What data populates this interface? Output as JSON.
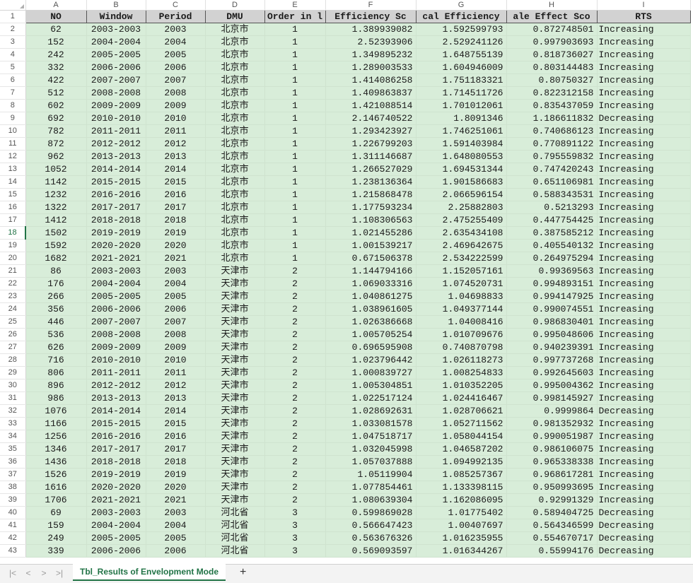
{
  "columns": [
    "A",
    "B",
    "C",
    "D",
    "E",
    "F",
    "G",
    "H",
    "I"
  ],
  "header": [
    "NO",
    "Window",
    "Period",
    "DMU",
    "Order in l",
    "Efficiency Sc",
    "cal Efficiency",
    "ale Effect Sco",
    "RTS"
  ],
  "active_row": 18,
  "rows": [
    [
      "62",
      "2003-2003",
      "2003",
      "北京市",
      "1",
      "1.389939082",
      "1.592599793",
      "0.872748501",
      "Increasing"
    ],
    [
      "152",
      "2004-2004",
      "2004",
      "北京市",
      "1",
      "2.52393906",
      "2.529241126",
      "0.997903693",
      "Increasing"
    ],
    [
      "242",
      "2005-2005",
      "2005",
      "北京市",
      "1",
      "1.349895232",
      "1.648755139",
      "0.818736027",
      "Increasing"
    ],
    [
      "332",
      "2006-2006",
      "2006",
      "北京市",
      "1",
      "1.289003533",
      "1.604946009",
      "0.803144483",
      "Increasing"
    ],
    [
      "422",
      "2007-2007",
      "2007",
      "北京市",
      "1",
      "1.414086258",
      "1.751183321",
      "0.80750327",
      "Increasing"
    ],
    [
      "512",
      "2008-2008",
      "2008",
      "北京市",
      "1",
      "1.409863837",
      "1.714511726",
      "0.822312158",
      "Increasing"
    ],
    [
      "602",
      "2009-2009",
      "2009",
      "北京市",
      "1",
      "1.421088514",
      "1.701012061",
      "0.835437059",
      "Increasing"
    ],
    [
      "692",
      "2010-2010",
      "2010",
      "北京市",
      "1",
      "2.146740522",
      "1.8091346",
      "1.186611832",
      "Decreasing"
    ],
    [
      "782",
      "2011-2011",
      "2011",
      "北京市",
      "1",
      "1.293423927",
      "1.746251061",
      "0.740686123",
      "Increasing"
    ],
    [
      "872",
      "2012-2012",
      "2012",
      "北京市",
      "1",
      "1.226799203",
      "1.591403984",
      "0.770891122",
      "Increasing"
    ],
    [
      "962",
      "2013-2013",
      "2013",
      "北京市",
      "1",
      "1.311146687",
      "1.648080553",
      "0.795559832",
      "Increasing"
    ],
    [
      "1052",
      "2014-2014",
      "2014",
      "北京市",
      "1",
      "1.266527029",
      "1.694531344",
      "0.747420243",
      "Increasing"
    ],
    [
      "1142",
      "2015-2015",
      "2015",
      "北京市",
      "1",
      "1.238136364",
      "1.901586683",
      "0.651106981",
      "Increasing"
    ],
    [
      "1232",
      "2016-2016",
      "2016",
      "北京市",
      "1",
      "1.215868478",
      "2.066596154",
      "0.588343531",
      "Increasing"
    ],
    [
      "1322",
      "2017-2017",
      "2017",
      "北京市",
      "1",
      "1.177593234",
      "2.25882803",
      "0.5213293",
      "Increasing"
    ],
    [
      "1412",
      "2018-2018",
      "2018",
      "北京市",
      "1",
      "1.108306563",
      "2.475255409",
      "0.447754425",
      "Increasing"
    ],
    [
      "1502",
      "2019-2019",
      "2019",
      "北京市",
      "1",
      "1.021455286",
      "2.635434108",
      "0.387585212",
      "Increasing"
    ],
    [
      "1592",
      "2020-2020",
      "2020",
      "北京市",
      "1",
      "1.001539217",
      "2.469642675",
      "0.405540132",
      "Increasing"
    ],
    [
      "1682",
      "2021-2021",
      "2021",
      "北京市",
      "1",
      "0.671506378",
      "2.534222599",
      "0.264975294",
      "Increasing"
    ],
    [
      "86",
      "2003-2003",
      "2003",
      "天津市",
      "2",
      "1.144794166",
      "1.152057161",
      "0.99369563",
      "Increasing"
    ],
    [
      "176",
      "2004-2004",
      "2004",
      "天津市",
      "2",
      "1.069033316",
      "1.074520731",
      "0.994893151",
      "Increasing"
    ],
    [
      "266",
      "2005-2005",
      "2005",
      "天津市",
      "2",
      "1.040861275",
      "1.04698833",
      "0.994147925",
      "Increasing"
    ],
    [
      "356",
      "2006-2006",
      "2006",
      "天津市",
      "2",
      "1.038961605",
      "1.049377144",
      "0.990074551",
      "Increasing"
    ],
    [
      "446",
      "2007-2007",
      "2007",
      "天津市",
      "2",
      "1.026386668",
      "1.04008416",
      "0.986830401",
      "Increasing"
    ],
    [
      "536",
      "2008-2008",
      "2008",
      "天津市",
      "2",
      "1.005705254",
      "1.010709676",
      "0.995048606",
      "Increasing"
    ],
    [
      "626",
      "2009-2009",
      "2009",
      "天津市",
      "2",
      "0.696595908",
      "0.740870798",
      "0.940239391",
      "Increasing"
    ],
    [
      "716",
      "2010-2010",
      "2010",
      "天津市",
      "2",
      "1.023796442",
      "1.026118273",
      "0.997737268",
      "Increasing"
    ],
    [
      "806",
      "2011-2011",
      "2011",
      "天津市",
      "2",
      "1.000839727",
      "1.008254833",
      "0.992645603",
      "Increasing"
    ],
    [
      "896",
      "2012-2012",
      "2012",
      "天津市",
      "2",
      "1.005304851",
      "1.010352205",
      "0.995004362",
      "Increasing"
    ],
    [
      "986",
      "2013-2013",
      "2013",
      "天津市",
      "2",
      "1.022517124",
      "1.024416467",
      "0.998145927",
      "Increasing"
    ],
    [
      "1076",
      "2014-2014",
      "2014",
      "天津市",
      "2",
      "1.028692631",
      "1.028706621",
      "0.9999864",
      "Decreasing"
    ],
    [
      "1166",
      "2015-2015",
      "2015",
      "天津市",
      "2",
      "1.033081578",
      "1.052711562",
      "0.981352932",
      "Increasing"
    ],
    [
      "1256",
      "2016-2016",
      "2016",
      "天津市",
      "2",
      "1.047518717",
      "1.058044154",
      "0.990051987",
      "Increasing"
    ],
    [
      "1346",
      "2017-2017",
      "2017",
      "天津市",
      "2",
      "1.032045998",
      "1.046587202",
      "0.986106075",
      "Increasing"
    ],
    [
      "1436",
      "2018-2018",
      "2018",
      "天津市",
      "2",
      "1.057037888",
      "1.094992135",
      "0.965338338",
      "Increasing"
    ],
    [
      "1526",
      "2019-2019",
      "2019",
      "天津市",
      "2",
      "1.05119904",
      "1.085257367",
      "0.968617281",
      "Increasing"
    ],
    [
      "1616",
      "2020-2020",
      "2020",
      "天津市",
      "2",
      "1.077854461",
      "1.133398115",
      "0.950993695",
      "Increasing"
    ],
    [
      "1706",
      "2021-2021",
      "2021",
      "天津市",
      "2",
      "1.080639304",
      "1.162086095",
      "0.92991329",
      "Increasing"
    ],
    [
      "69",
      "2003-2003",
      "2003",
      "河北省",
      "3",
      "0.599869028",
      "1.01775402",
      "0.589404725",
      "Decreasing"
    ],
    [
      "159",
      "2004-2004",
      "2004",
      "河北省",
      "3",
      "0.566647423",
      "1.00407697",
      "0.564346599",
      "Decreasing"
    ],
    [
      "249",
      "2005-2005",
      "2005",
      "河北省",
      "3",
      "0.563676326",
      "1.016235955",
      "0.554670717",
      "Decreasing"
    ],
    [
      "339",
      "2006-2006",
      "2006",
      "河北省",
      "3",
      "0.569093597",
      "1.016344267",
      "0.55994176",
      "Decreasing"
    ]
  ],
  "sheet_tab": "Tbl_Results of Envelopment Mode",
  "nav": {
    "first": "|<",
    "prev": "<",
    "next": ">",
    "last": ">|",
    "add": "+"
  },
  "colors": {
    "header_bg": "#d2d2d2",
    "cell_bg": "#d8edd9",
    "accent": "#217346"
  }
}
